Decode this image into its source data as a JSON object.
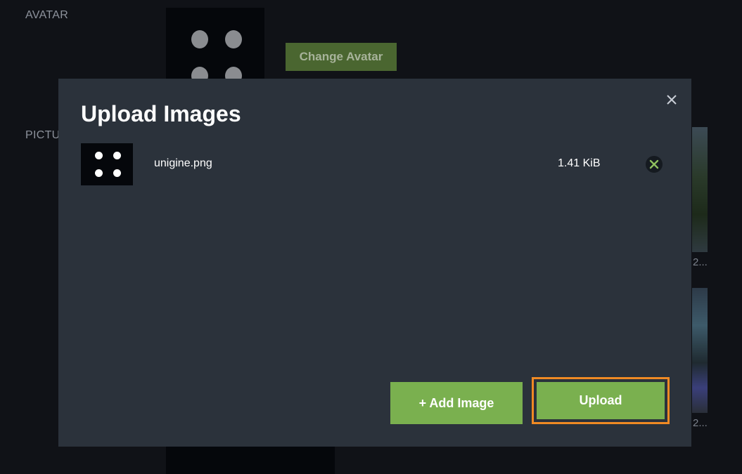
{
  "background": {
    "avatar_label": "AVATAR",
    "pictures_label": "PICTU",
    "change_avatar_label": "Change Avatar",
    "thumb_caption_1": "2...",
    "thumb_caption_2": "2..."
  },
  "modal": {
    "title": "Upload Images",
    "close_icon": "close-icon",
    "files": [
      {
        "name": "unigine.png",
        "size": "1.41 KiB",
        "remove_icon": "x-mark-icon"
      }
    ],
    "add_image_label": "+ Add Image",
    "upload_label": "Upload"
  },
  "colors": {
    "accent_green": "#7ab04f",
    "focus_outline": "#f08a24",
    "modal_bg": "#2b323b",
    "page_bg": "#101217"
  }
}
